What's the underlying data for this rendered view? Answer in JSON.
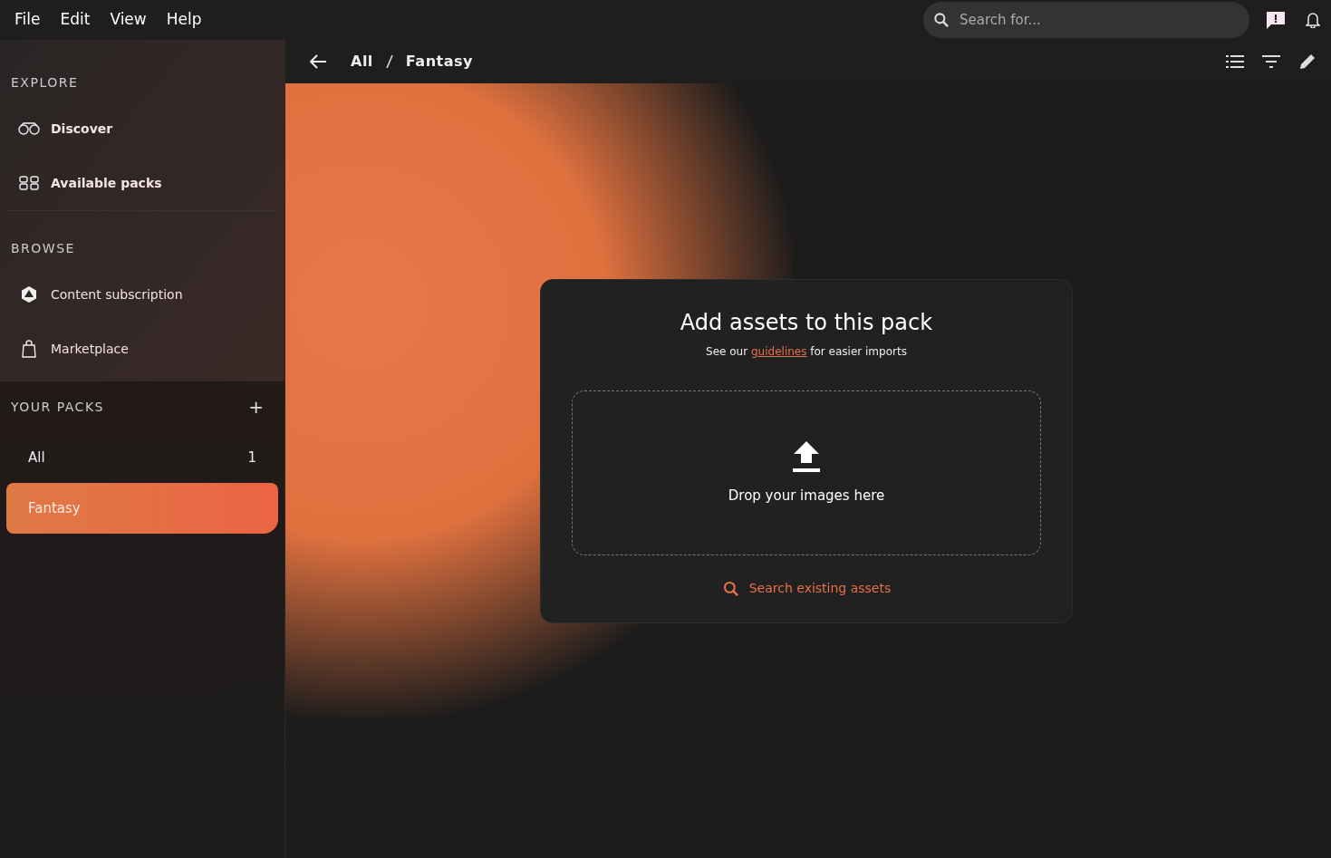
{
  "menu_bar": [
    "File",
    "Edit",
    "View",
    "Help"
  ],
  "search": {
    "placeholder": "Search for..."
  },
  "sidebar": {
    "sections": [
      {
        "title": "EXPLORE",
        "items": [
          {
            "label": "Discover",
            "kind": "binoculars"
          },
          {
            "label": "Available packs",
            "kind": "grid"
          }
        ]
      },
      {
        "title": "BROWSE",
        "items": [
          {
            "label": "Content subscription",
            "kind": "dice"
          },
          {
            "label": "Marketplace",
            "kind": "bag"
          }
        ]
      }
    ],
    "your_packs": {
      "title": "YOUR PACKS",
      "add": "+",
      "items": [
        {
          "label": "All",
          "count": "1",
          "selected": false
        },
        {
          "label": "Fantasy",
          "selected": true
        }
      ]
    }
  },
  "breadcrumb": [
    "All",
    "Fantasy"
  ],
  "panel": {
    "title": "Add assets to this pack",
    "subtitle_before": "See our",
    "subtitle_link": "guidelines",
    "subtitle_after": "for easier imports",
    "drop_label": "Drop your images here",
    "search_link": "Search existing assets"
  }
}
